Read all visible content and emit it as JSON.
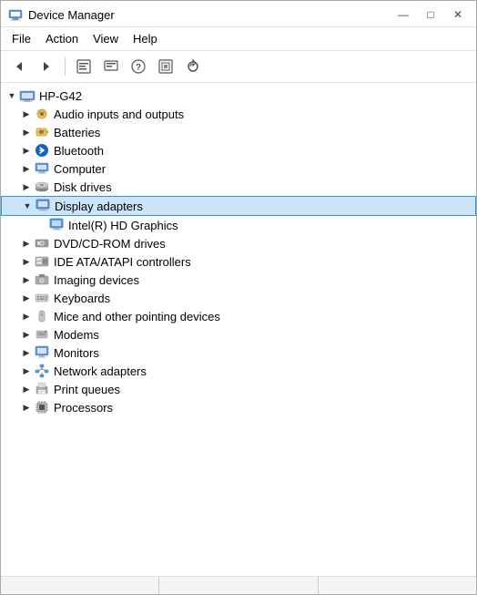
{
  "window": {
    "title": "Device Manager",
    "controls": {
      "minimize": "—",
      "maximize": "□",
      "close": "✕"
    }
  },
  "menu": {
    "items": [
      "File",
      "Action",
      "View",
      "Help"
    ]
  },
  "toolbar": {
    "buttons": [
      "◀",
      "▶",
      "⊞",
      "≡",
      "?",
      "⊡",
      "🔄"
    ]
  },
  "tree": {
    "root": {
      "label": "HP-G42",
      "icon": "computer"
    },
    "items": [
      {
        "id": "audio",
        "label": "Audio inputs and outputs",
        "icon": "audio",
        "expanded": false,
        "indent": 1
      },
      {
        "id": "batteries",
        "label": "Batteries",
        "icon": "battery",
        "expanded": false,
        "indent": 1
      },
      {
        "id": "bluetooth",
        "label": "Bluetooth",
        "icon": "bluetooth",
        "expanded": false,
        "indent": 1
      },
      {
        "id": "computer",
        "label": "Computer",
        "icon": "computer2",
        "expanded": false,
        "indent": 1
      },
      {
        "id": "disk",
        "label": "Disk drives",
        "icon": "disk",
        "expanded": false,
        "indent": 1
      },
      {
        "id": "display",
        "label": "Display adapters",
        "icon": "display",
        "expanded": true,
        "selected": true,
        "indent": 1
      },
      {
        "id": "intel",
        "label": "Intel(R) HD Graphics",
        "icon": "intel",
        "child": true,
        "indent": 2
      },
      {
        "id": "dvd",
        "label": "DVD/CD-ROM drives",
        "icon": "dvd",
        "expanded": false,
        "indent": 1
      },
      {
        "id": "ide",
        "label": "IDE ATA/ATAPI controllers",
        "icon": "ide",
        "expanded": false,
        "indent": 1
      },
      {
        "id": "imaging",
        "label": "Imaging devices",
        "icon": "imaging",
        "expanded": false,
        "indent": 1
      },
      {
        "id": "keyboard",
        "label": "Keyboards",
        "icon": "keyboard",
        "expanded": false,
        "indent": 1
      },
      {
        "id": "mice",
        "label": "Mice and other pointing devices",
        "icon": "mice",
        "expanded": false,
        "indent": 1
      },
      {
        "id": "modems",
        "label": "Modems",
        "icon": "modem",
        "expanded": false,
        "indent": 1
      },
      {
        "id": "monitors",
        "label": "Monitors",
        "icon": "monitor",
        "expanded": false,
        "indent": 1
      },
      {
        "id": "network",
        "label": "Network adapters",
        "icon": "network",
        "expanded": false,
        "indent": 1
      },
      {
        "id": "print",
        "label": "Print queues",
        "icon": "print",
        "expanded": false,
        "indent": 1
      },
      {
        "id": "proc",
        "label": "Processors",
        "icon": "proc",
        "expanded": false,
        "indent": 1
      }
    ]
  }
}
